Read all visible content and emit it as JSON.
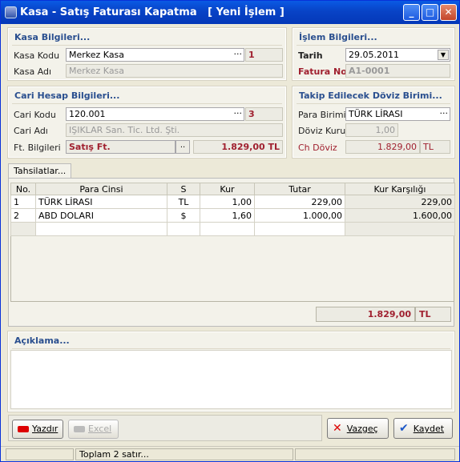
{
  "window": {
    "title": "Kasa - Satış Faturası Kapatma   [ Yeni İşlem ]"
  },
  "kasa": {
    "section": "Kasa Bilgileri...",
    "kod_label": "Kasa Kodu",
    "kod_value": "Merkez Kasa",
    "kod_dots": "···",
    "kod_no": "1",
    "adi_label": "Kasa Adı",
    "adi_value": "Merkez Kasa"
  },
  "islem": {
    "section": "İşlem Bilgileri...",
    "tarih_label": "Tarih",
    "tarih_value": "29.05.2011",
    "fatura_label": "Fatura No.",
    "fatura_value": "A1-0001"
  },
  "cari": {
    "section": "Cari Hesap Bilgileri...",
    "kod_label": "Cari Kodu",
    "kod_value": "120.001",
    "kod_dots": "···",
    "kod_no": "3",
    "adi_label": "Cari Adı",
    "adi_value": "IŞIKLAR San. Tic. Ltd. Şti.",
    "ft_label": "Ft. Bilgileri",
    "ft_value": "Satış Ft.",
    "ft_btn": "..",
    "ft_amount": "1.829,00 TL"
  },
  "doviz": {
    "section": "Takip Edilecek Döviz Birimi...",
    "para_label": "Para Birimi",
    "para_value": "TÜRK LİRASI",
    "para_dots": "···",
    "kur_label": "Döviz Kuru",
    "kur_value": "1,00",
    "ch_label": "Ch Döviz",
    "ch_value": "1.829,00",
    "ch_unit": "TL"
  },
  "tahsilat": {
    "tab": "Tahsilatlar...",
    "columns": [
      "No.",
      "Para Cinsi",
      "S",
      "Kur",
      "Tutar",
      "Kur Karşılığı"
    ],
    "rows": [
      [
        "1",
        "TÜRK LİRASI",
        "TL",
        "1,00",
        "229,00",
        "229,00"
      ],
      [
        "2",
        "ABD DOLARI",
        "$",
        "1,60",
        "1.000,00",
        "1.600,00"
      ]
    ],
    "total": "1.829,00",
    "total_unit": "TL"
  },
  "aciklama": {
    "section": "Açıklama..."
  },
  "buttons": {
    "yazdir": "Yazdır",
    "excel": "Excel",
    "vazgec": "Vazgeç",
    "kaydet": "Kaydet"
  },
  "status": {
    "text": "Toplam 2 satır..."
  },
  "colors": {
    "title_bar": "#0a5ae4",
    "section_title": "#2a4f8f",
    "accent_red": "#a0202f"
  }
}
